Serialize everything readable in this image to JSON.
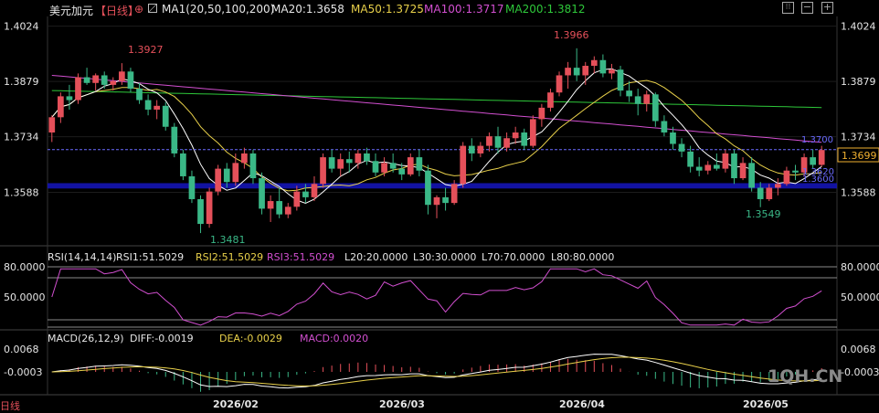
{
  "header": {
    "symbol": "美元加元",
    "period": "【日线】",
    "ma_label": "MA1(20,50,100,200)",
    "ma20": "MA20:1.3658",
    "ma50": "MA50:1.3725",
    "ma100": "MA100:1.3717",
    "ma200": "MA200:1.3812"
  },
  "colors": {
    "background": "#000000",
    "up": "#e5505a",
    "down": "#3ab887",
    "ma20": "#ffffff",
    "ma50": "#e8d04a",
    "ma100": "#d24fd0",
    "ma200": "#2ec83a",
    "rsi": "#d24fd0",
    "dea": "#e8d04a",
    "price_tag": "#f0b030",
    "dashed": "#6a6aff",
    "support_band": "#1414b4"
  },
  "toolbar_icons": [
    "settings-grid-icon",
    "minus-icon",
    "plus-icon"
  ],
  "main_chart": {
    "y_ticks": [
      "1.4024",
      "1.3879",
      "1.3734",
      "1.3588"
    ],
    "high_label": "1.3927",
    "high2_label": "1.3966",
    "low_label": "1.3481",
    "low2_label": "1.3549",
    "last_price": "1.3699",
    "line_label_1": "1.3700",
    "line_label_2": "1.3620",
    "line_label_3": "1.3600"
  },
  "rsi_panel": {
    "label": "RSI(14,14,14)",
    "rsi1": "RSI1:51.5029",
    "rsi2": "RSI2:51.5029",
    "rsi3": "RSI3:51.5029",
    "l20": "L20:20.0000",
    "l30": "L30:30.0000",
    "l70": "L70:70.0000",
    "l80": "L80:80.0000",
    "y_ticks": [
      "80.0000",
      "50.0000"
    ]
  },
  "macd_panel": {
    "label": "MACD(26,12,9)",
    "diff": "DIFF:-0.0019",
    "dea": "DEA:-0.0029",
    "macd": "MACD:0.0020",
    "y_ticks": [
      "0.0068",
      "-0.0003"
    ]
  },
  "x_axis": [
    "2026/02",
    "2026/03",
    "2026/04",
    "2026/05"
  ],
  "corner_label": "日线",
  "watermark": "1QH.CN",
  "chart_data": {
    "type": "candlestick",
    "y_range": [
      1.345,
      1.404
    ],
    "candles": [
      [
        1.3745,
        1.379,
        1.372,
        1.3785
      ],
      [
        1.3785,
        1.385,
        1.377,
        1.384
      ],
      [
        1.384,
        1.387,
        1.3805,
        1.383
      ],
      [
        1.383,
        1.39,
        1.382,
        1.389
      ],
      [
        1.389,
        1.3915,
        1.387,
        1.3875
      ],
      [
        1.3875,
        1.39,
        1.3855,
        1.3895
      ],
      [
        1.3895,
        1.3905,
        1.386,
        1.387
      ],
      [
        1.387,
        1.389,
        1.3855,
        1.388
      ],
      [
        1.388,
        1.3927,
        1.387,
        1.3905
      ],
      [
        1.3905,
        1.3915,
        1.385,
        1.386
      ],
      [
        1.386,
        1.3875,
        1.382,
        1.383
      ],
      [
        1.383,
        1.3845,
        1.379,
        1.3805
      ],
      [
        1.3805,
        1.383,
        1.378,
        1.3815
      ],
      [
        1.3815,
        1.3825,
        1.375,
        1.376
      ],
      [
        1.376,
        1.377,
        1.368,
        1.369
      ],
      [
        1.369,
        1.37,
        1.362,
        1.363
      ],
      [
        1.363,
        1.3645,
        1.356,
        1.357
      ],
      [
        1.357,
        1.358,
        1.3481,
        1.3505
      ],
      [
        1.3505,
        1.36,
        1.3495,
        1.359
      ],
      [
        1.359,
        1.366,
        1.358,
        1.365
      ],
      [
        1.365,
        1.3665,
        1.36,
        1.3615
      ],
      [
        1.3615,
        1.369,
        1.3605,
        1.3665
      ],
      [
        1.3665,
        1.3705,
        1.365,
        1.369
      ],
      [
        1.369,
        1.37,
        1.361,
        1.3625
      ],
      [
        1.3625,
        1.364,
        1.353,
        1.3545
      ],
      [
        1.3545,
        1.358,
        1.351,
        1.3565
      ],
      [
        1.3565,
        1.36,
        1.352,
        1.353
      ],
      [
        1.353,
        1.356,
        1.352,
        1.355
      ],
      [
        1.355,
        1.3605,
        1.354,
        1.359
      ],
      [
        1.359,
        1.361,
        1.356,
        1.3575
      ],
      [
        1.3575,
        1.363,
        1.3565,
        1.361
      ],
      [
        1.361,
        1.369,
        1.36,
        1.368
      ],
      [
        1.368,
        1.37,
        1.364,
        1.365
      ],
      [
        1.365,
        1.369,
        1.363,
        1.3675
      ],
      [
        1.3675,
        1.3695,
        1.364,
        1.3665
      ],
      [
        1.3665,
        1.37,
        1.365,
        1.369
      ],
      [
        1.369,
        1.3705,
        1.366,
        1.367
      ],
      [
        1.367,
        1.369,
        1.363,
        1.364
      ],
      [
        1.364,
        1.368,
        1.363,
        1.3665
      ],
      [
        1.3665,
        1.369,
        1.364,
        1.365
      ],
      [
        1.365,
        1.3665,
        1.362,
        1.3635
      ],
      [
        1.3635,
        1.369,
        1.363,
        1.368
      ],
      [
        1.368,
        1.37,
        1.363,
        1.3645
      ],
      [
        1.3645,
        1.366,
        1.353,
        1.3555
      ],
      [
        1.3555,
        1.358,
        1.352,
        1.3575
      ],
      [
        1.3575,
        1.36,
        1.354,
        1.356
      ],
      [
        1.356,
        1.362,
        1.3555,
        1.361
      ],
      [
        1.361,
        1.372,
        1.36,
        1.371
      ],
      [
        1.371,
        1.373,
        1.367,
        1.369
      ],
      [
        1.369,
        1.372,
        1.368,
        1.371
      ],
      [
        1.371,
        1.3745,
        1.3695,
        1.3735
      ],
      [
        1.3735,
        1.376,
        1.369,
        1.3705
      ],
      [
        1.3705,
        1.3745,
        1.3695,
        1.373
      ],
      [
        1.373,
        1.376,
        1.3715,
        1.3745
      ],
      [
        1.3745,
        1.3755,
        1.37,
        1.371
      ],
      [
        1.371,
        1.379,
        1.3705,
        1.378
      ],
      [
        1.378,
        1.382,
        1.376,
        1.381
      ],
      [
        1.381,
        1.386,
        1.38,
        1.385
      ],
      [
        1.385,
        1.3905,
        1.384,
        1.3895
      ],
      [
        1.3895,
        1.393,
        1.386,
        1.3915
      ],
      [
        1.3915,
        1.3966,
        1.388,
        1.3895
      ],
      [
        1.3895,
        1.393,
        1.387,
        1.392
      ],
      [
        1.392,
        1.3945,
        1.39,
        1.3935
      ],
      [
        1.3935,
        1.395,
        1.389,
        1.39
      ],
      [
        1.39,
        1.3925,
        1.3885,
        1.391
      ],
      [
        1.391,
        1.392,
        1.384,
        1.3855
      ],
      [
        1.3855,
        1.388,
        1.3825,
        1.384
      ],
      [
        1.384,
        1.386,
        1.379,
        1.382
      ],
      [
        1.382,
        1.3855,
        1.38,
        1.3845
      ],
      [
        1.3845,
        1.385,
        1.376,
        1.3775
      ],
      [
        1.3775,
        1.379,
        1.3735,
        1.3745
      ],
      [
        1.3745,
        1.376,
        1.37,
        1.3715
      ],
      [
        1.3715,
        1.373,
        1.368,
        1.3695
      ],
      [
        1.3695,
        1.371,
        1.364,
        1.3655
      ],
      [
        1.3655,
        1.368,
        1.363,
        1.3645
      ],
      [
        1.3645,
        1.367,
        1.3635,
        1.366
      ],
      [
        1.366,
        1.369,
        1.3645,
        1.365
      ],
      [
        1.365,
        1.37,
        1.364,
        1.369
      ],
      [
        1.369,
        1.37,
        1.361,
        1.3625
      ],
      [
        1.3625,
        1.368,
        1.362,
        1.3665
      ],
      [
        1.3665,
        1.368,
        1.359,
        1.36
      ],
      [
        1.36,
        1.3615,
        1.3549,
        1.357
      ],
      [
        1.357,
        1.361,
        1.3565,
        1.36
      ],
      [
        1.36,
        1.3625,
        1.358,
        1.361
      ],
      [
        1.361,
        1.3655,
        1.3605,
        1.3645
      ],
      [
        1.3645,
        1.366,
        1.362,
        1.364
      ],
      [
        1.364,
        1.369,
        1.363,
        1.368
      ],
      [
        1.368,
        1.37,
        1.365,
        1.366
      ],
      [
        1.366,
        1.371,
        1.3655,
        1.3699
      ]
    ]
  }
}
